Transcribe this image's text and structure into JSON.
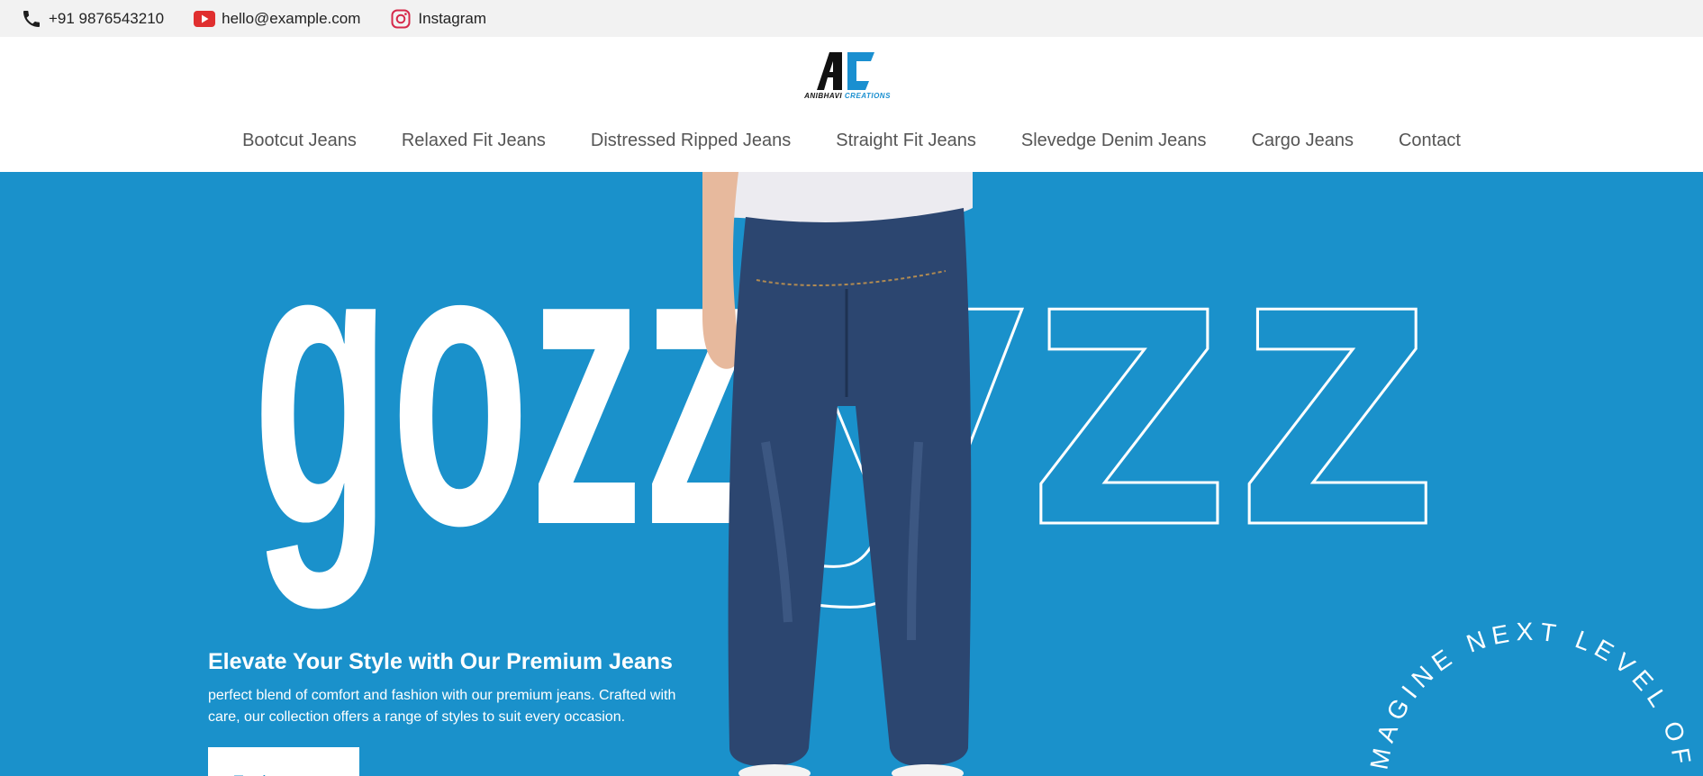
{
  "topbar": {
    "phone": "+91 9876543210",
    "email": "hello@example.com",
    "instagram": "Instagram"
  },
  "brand": {
    "logo_letters": "AC",
    "tagline_part1": "ANIBHAVI",
    "tagline_part2": "CREATIONS"
  },
  "nav": {
    "items": [
      {
        "label": "Bootcut Jeans"
      },
      {
        "label": "Relaxed Fit Jeans"
      },
      {
        "label": "Distressed Ripped Jeans"
      },
      {
        "label": "Straight Fit Jeans"
      },
      {
        "label": "Slevedge Denim Jeans"
      },
      {
        "label": "Cargo Jeans"
      },
      {
        "label": "Contact"
      }
    ]
  },
  "hero": {
    "big_text_solid": "gozz",
    "big_text_outline": "yzz",
    "heading": "Elevate Your Style with Our Premium Jeans",
    "description": "perfect blend of comfort and fashion with our premium jeans. Crafted with care, our collection offers a range of styles to suit every occasion.",
    "button_label": "Explore more",
    "circle_text": "IMAGINE NEXT LEVEL OF FASHION"
  },
  "colors": {
    "accent": "#1a91cb",
    "topbar_bg": "#f2f2f2",
    "youtube_red": "#e02f2f",
    "instagram_red": "#d6294a",
    "denim": "#2c4670"
  },
  "icons": {
    "phone": "phone-icon",
    "email": "youtube-icon",
    "instagram": "instagram-icon"
  }
}
